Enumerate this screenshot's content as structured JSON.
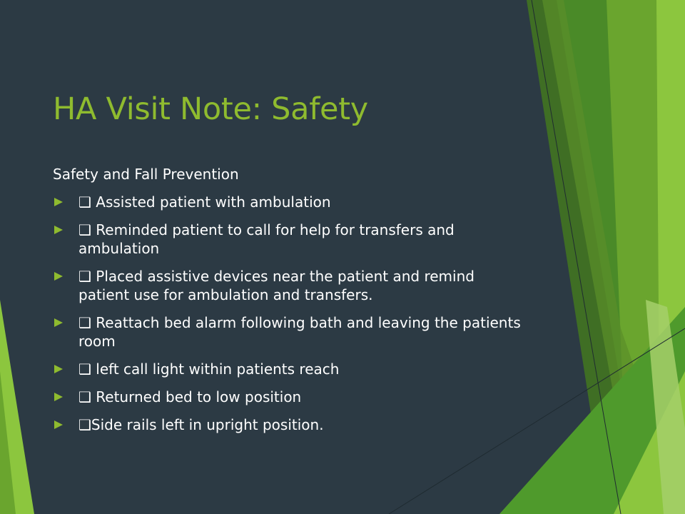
{
  "slide": {
    "title": "HA Visit Note: Safety",
    "subtitle": "Safety and Fall Prevention",
    "items": [
      "❑ Assisted patient with ambulation",
      "❑ Reminded patient to call for help for transfers and ambulation",
      "❑ Placed assistive devices near the patient and remind patient use for ambulation and transfers.",
      "❑ Reattach bed alarm following bath and leaving the patients room",
      "❑ left  call light within patients reach",
      "❑ Returned bed to low position",
      "❑Side rails left in upright position."
    ],
    "bullet_icon": "triangle-bullet-icon"
  },
  "colors": {
    "background": "#2c3a44",
    "accent": "#8fbb2f",
    "text": "#ffffff"
  }
}
